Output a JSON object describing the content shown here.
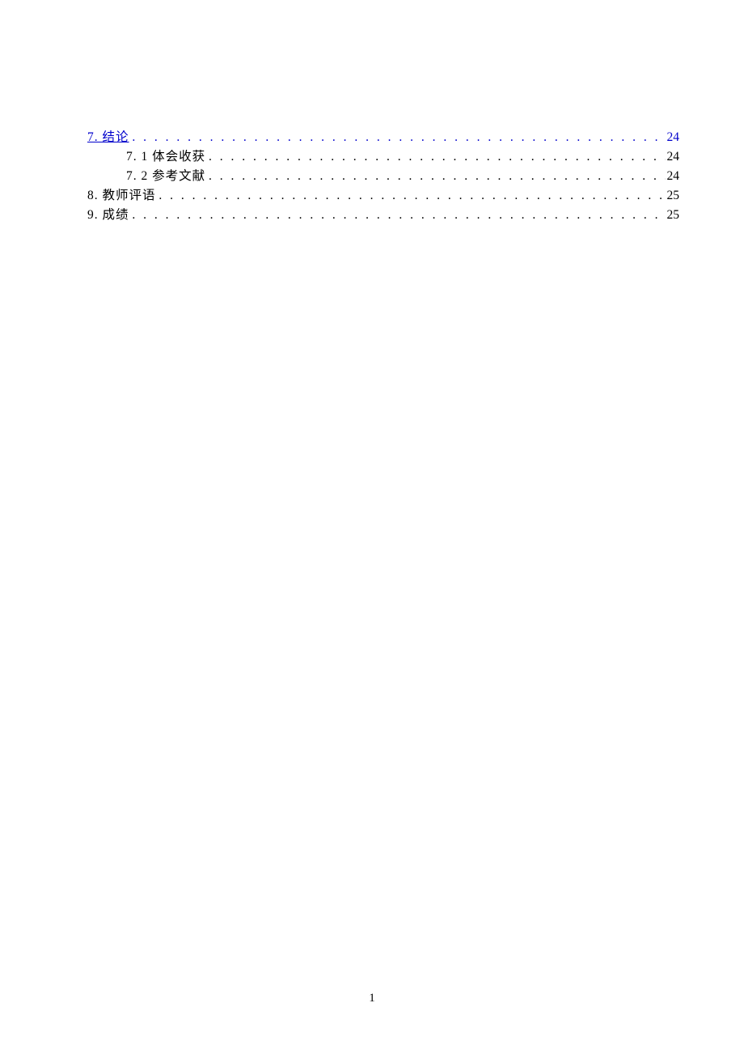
{
  "toc": {
    "dots": ". . . . . . . . . . . . . . . . . . . . . . . . . . . . . . . . . . . . . . . . . . . . . . . . . . . . . . . . . . . . . . . . . . . . . . . . . . . . . . . . . . . . . . . . . . . . . . . . . . . . . . . . . . . . . . . . . . . . . . . . . . . . . . . . . . . . . . . . . . . . . . . .",
    "entries": [
      {
        "title": "7. 结论",
        "page": "24",
        "level": 1,
        "link": true
      },
      {
        "title": "7. 1 体会收获",
        "page": "24",
        "level": 2,
        "link": false
      },
      {
        "title": "7. 2 参考文献",
        "page": "24",
        "level": 2,
        "link": false
      },
      {
        "title": "8. 教师评语",
        "page": "25",
        "level": 1,
        "link": false
      },
      {
        "title": "9. 成绩",
        "page": "25",
        "level": 1,
        "link": false
      }
    ]
  },
  "footer": {
    "page_number": "1"
  }
}
